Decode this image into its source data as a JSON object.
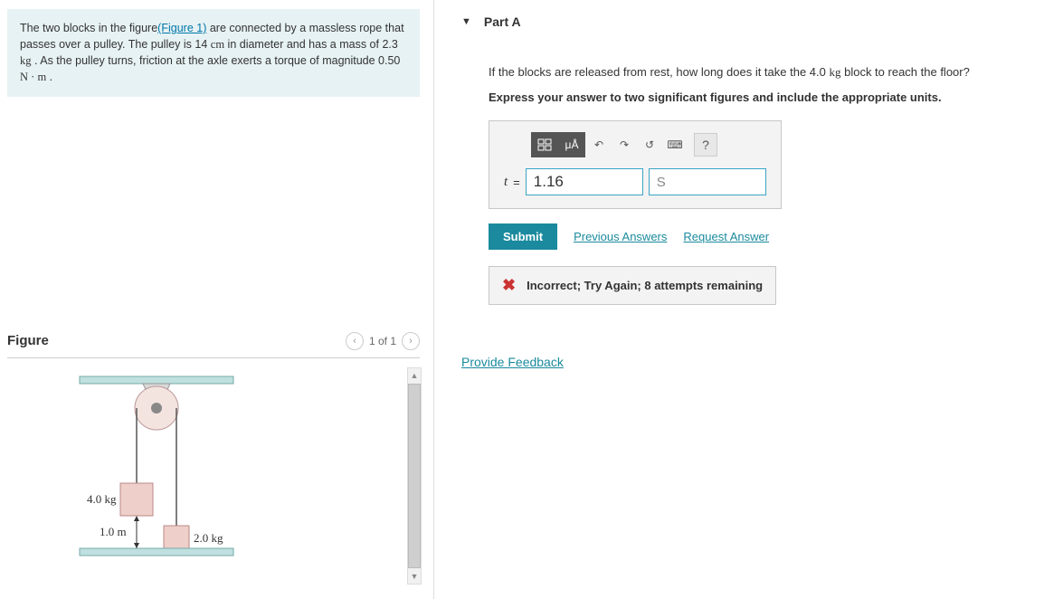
{
  "problem": {
    "text_before_link": "The two blocks in the figure",
    "figure_link": "(Figure 1)",
    "text_after_link": " are connected by a massless rope that passes over a pulley. The pulley is 14 ",
    "unit_cm": "cm",
    "text_mid1": " in diameter and has a mass of 2.3 ",
    "unit_kg": "kg",
    "text_mid2": " . As the pulley turns, friction at the axle exerts a torque of magnitude 0.50 ",
    "unit_nm": "N · m",
    "text_end": " ."
  },
  "figure": {
    "title": "Figure",
    "pager": "1 of 1",
    "labels": {
      "mass1": "4.0 kg",
      "mass2": "2.0 kg",
      "height": "1.0 m"
    }
  },
  "part": {
    "title": "Part A",
    "question_before": "If the blocks are released from rest, how long does it take the 4.0 ",
    "question_unit": "kg",
    "question_after": " block to reach the floor?",
    "instruction": "Express your answer to two significant figures and include the appropriate units.",
    "toolbar": {
      "units_label": "μÅ",
      "help": "?"
    },
    "answer": {
      "var": "t",
      "eq": "=",
      "value": "1.16",
      "unit_placeholder": "S"
    },
    "actions": {
      "submit": "Submit",
      "previous": "Previous Answers",
      "request": "Request Answer"
    },
    "feedback": "Incorrect; Try Again; 8 attempts remaining"
  },
  "links": {
    "provide_feedback": "Provide Feedback"
  }
}
